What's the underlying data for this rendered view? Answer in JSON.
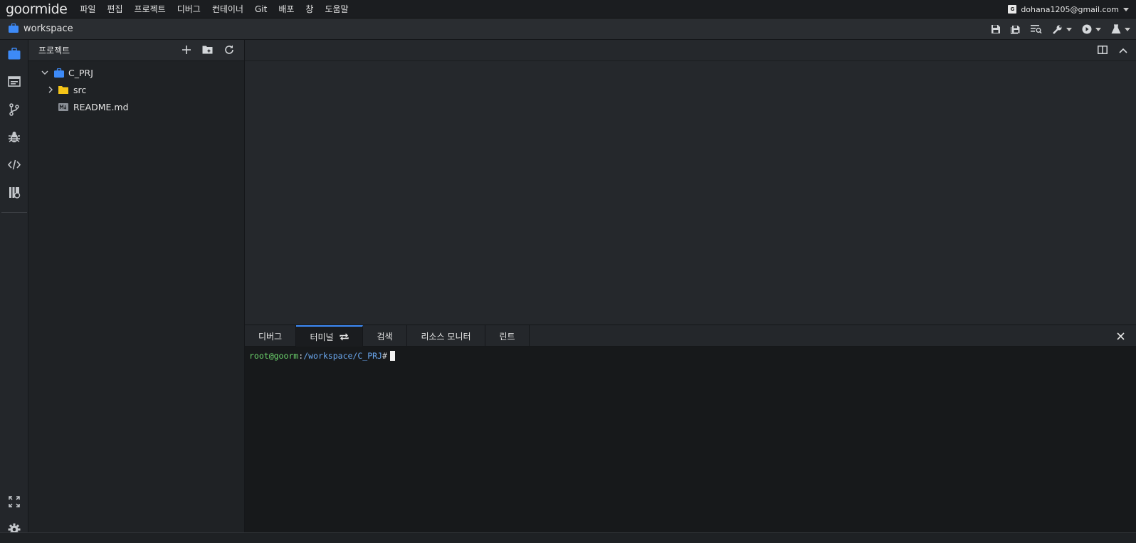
{
  "app": {
    "logo": "goormide",
    "user_email": "dohana1205@gmail.com",
    "user_badge": "G"
  },
  "menu": [
    "파일",
    "편집",
    "프로젝트",
    "디버그",
    "컨테이너",
    "Git",
    "배포",
    "창",
    "도움말"
  ],
  "toolbar": {
    "workspace_label": "workspace"
  },
  "explorer": {
    "title": "프로젝트",
    "tree": [
      {
        "label": "C_PRJ",
        "type": "project",
        "expanded": true
      },
      {
        "label": "src",
        "type": "folder",
        "expanded": false
      },
      {
        "label": "README.md",
        "type": "file"
      }
    ]
  },
  "panel": {
    "tabs": [
      "디버그",
      "터미널",
      "검색",
      "리소스 모니터",
      "린트"
    ],
    "active_tab": "터미널"
  },
  "terminal": {
    "user": "root@goorm",
    "separator": ":",
    "path": "/workspace/C_PRJ",
    "prompt": "#"
  },
  "colors": {
    "accent": "#3d8af7",
    "folder": "#f5c518",
    "terminal_user": "#6cd36c",
    "terminal_path": "#6aa7ee"
  }
}
